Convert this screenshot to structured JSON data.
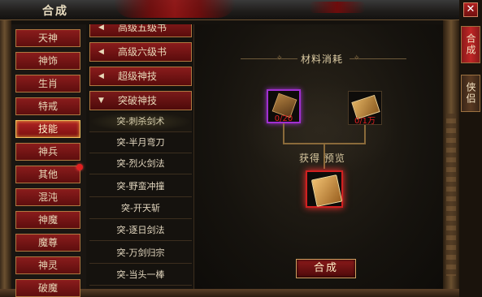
{
  "window": {
    "title": "合成",
    "close_label": "✕"
  },
  "categories": [
    {
      "label": "天神",
      "active": false
    },
    {
      "label": "神饰",
      "active": false
    },
    {
      "label": "生肖",
      "active": false
    },
    {
      "label": "特戒",
      "active": false
    },
    {
      "label": "技能",
      "active": true
    },
    {
      "label": "神兵",
      "active": false
    },
    {
      "label": "其他",
      "active": false,
      "badge": true
    },
    {
      "label": "混沌",
      "active": false
    },
    {
      "label": "神魔",
      "active": false
    },
    {
      "label": "魔尊",
      "active": false
    },
    {
      "label": "神灵",
      "active": false
    },
    {
      "label": "破魔",
      "active": false
    }
  ],
  "sub_headers": [
    {
      "label": "高级五级书",
      "arrow": "◀"
    },
    {
      "label": "高级六级书",
      "arrow": "◀"
    },
    {
      "label": "超级神技",
      "arrow": "◀"
    },
    {
      "label": "突破神技",
      "arrow": "▼"
    }
  ],
  "sub_items": [
    {
      "label": "突-刺杀剑术",
      "selected": true
    },
    {
      "label": "突-半月弯刀",
      "selected": false
    },
    {
      "label": "突-烈火剑法",
      "selected": false
    },
    {
      "label": "突-野蛮冲撞",
      "selected": false
    },
    {
      "label": "突-开天斩",
      "selected": false
    },
    {
      "label": "突-逐日剑法",
      "selected": false
    },
    {
      "label": "突-万剑归宗",
      "selected": false
    },
    {
      "label": "突-当头一棒",
      "selected": false
    }
  ],
  "materials": {
    "title": "材料消耗",
    "ornament": "✧",
    "items": [
      {
        "icon": "box-icon",
        "count": "0/20",
        "rarity": "purple"
      },
      {
        "icon": "book-icon",
        "count": "0/1万",
        "rarity": "normal"
      }
    ],
    "obtain_label": "获得  预览",
    "result": {
      "icon": "scroll-icon",
      "rarity": "red"
    }
  },
  "craft_button": "合成",
  "side_tabs": [
    {
      "label": "合成",
      "active": true
    },
    {
      "label": "侠侣",
      "active": false
    }
  ],
  "colors": {
    "accent_red": "#8a1c1c",
    "gold": "#d0a060",
    "purple": "#a030d0"
  }
}
